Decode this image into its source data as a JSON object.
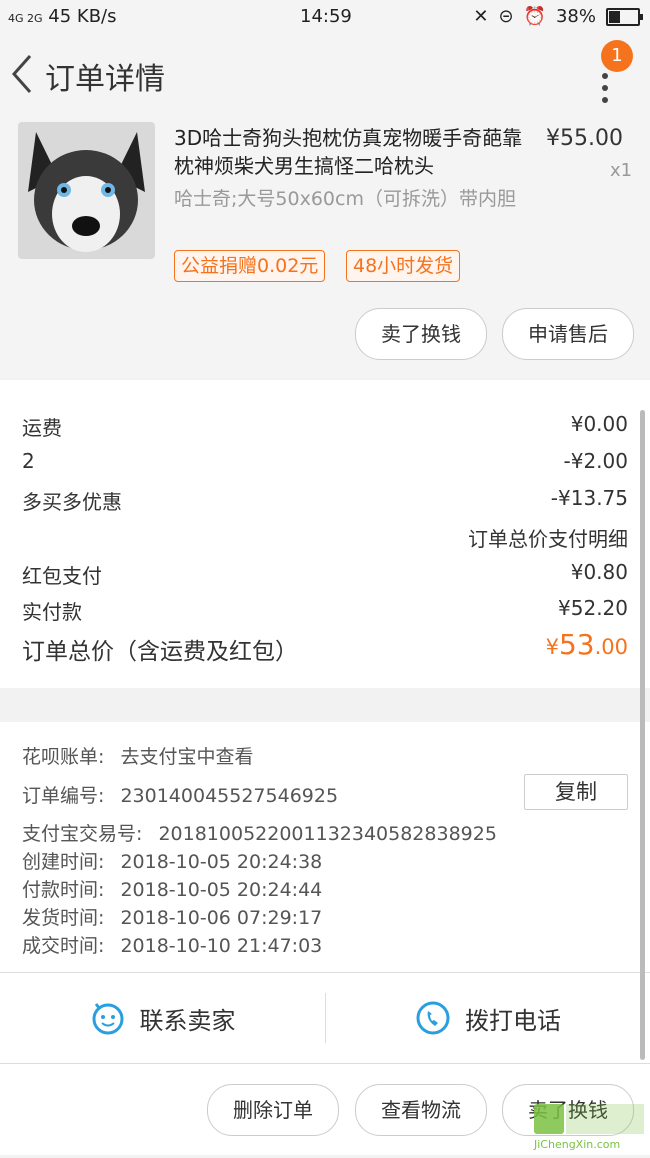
{
  "status_bar": {
    "signal": "4G 2G",
    "speed": "45 KB/s",
    "time": "14:59",
    "battery": "38%"
  },
  "header": {
    "title": "订单详情",
    "badge_count": "1"
  },
  "product": {
    "title": "3D哈士奇狗头抱枕仿真宠物暖手奇葩靠枕神烦柴犬男生搞怪二哈枕头",
    "price": "¥55.00",
    "qty": "x1",
    "sku": "哈士奇;大号50x60cm（可拆洗）带内胆",
    "tags": [
      "公益捐赠0.02元",
      "48小时发货"
    ],
    "buttons": [
      "卖了换钱",
      "申请售后"
    ]
  },
  "fees": {
    "rows": [
      {
        "label": "运费",
        "value": "¥0.00"
      },
      {
        "label": "2",
        "value": "-¥2.00"
      },
      {
        "label": "多买多优惠",
        "value": "-¥13.75"
      },
      {
        "label": "",
        "value": "订单总价支付明细"
      },
      {
        "label": "红包支付",
        "value": "¥0.80"
      },
      {
        "label": "实付款",
        "value": "¥52.20"
      }
    ],
    "total_label": "订单总价（含运费及红包）",
    "total_currency": "¥",
    "total_int": "53",
    "total_dec": ".00"
  },
  "info": {
    "rows": [
      {
        "label": "花呗账单:",
        "value": "去支付宝中查看"
      },
      {
        "label": "订单编号:",
        "value": "230140045527546925"
      },
      {
        "label": "支付宝交易号:",
        "value": "2018100522001132340582838925"
      },
      {
        "label": "创建时间:",
        "value": "2018-10-05 20:24:38"
      },
      {
        "label": "付款时间:",
        "value": "2018-10-05 20:24:44"
      },
      {
        "label": "发货时间:",
        "value": "2018-10-06 07:29:17"
      },
      {
        "label": "成交时间:",
        "value": "2018-10-10 21:47:03"
      }
    ],
    "copy_label": "复制"
  },
  "contact": {
    "seller": "联系卖家",
    "phone": "拨打电话"
  },
  "footer": {
    "buttons": [
      "删除订单",
      "查看物流",
      "卖了换钱"
    ]
  },
  "watermark": {
    "text": "JiChengXin.com"
  },
  "colors": {
    "accent": "#f5731d",
    "link_blue": "#2a9fe0"
  }
}
